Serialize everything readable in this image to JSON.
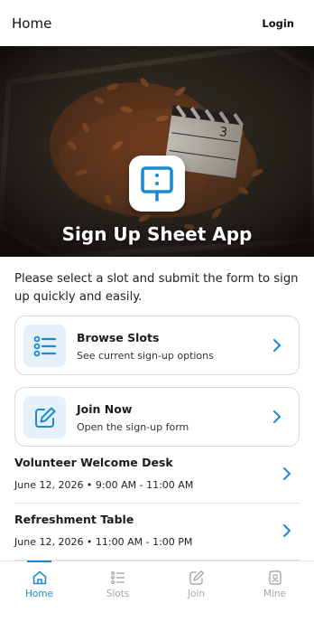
{
  "header": {
    "title": "Home",
    "login_label": "Login"
  },
  "hero": {
    "title": "Sign Up Sheet App",
    "icon": "easel-icon",
    "clapper_text": "3"
  },
  "intro_text": "Please select a slot and submit the form to sign up quickly and easily.",
  "cards": [
    {
      "title": "Browse Slots",
      "subtitle": "See current sign-up options",
      "icon": "list-icon"
    },
    {
      "title": "Join Now",
      "subtitle": "Open the sign-up form",
      "icon": "pencil-icon"
    }
  ],
  "slots": [
    {
      "title": "Volunteer Welcome Desk",
      "time": "June 12, 2026 • 9:00 AM - 11:00 AM"
    },
    {
      "title": "Refreshment Table",
      "time": "June 12, 2026 • 11:00 AM - 1:00 PM"
    }
  ],
  "tabs": [
    {
      "label": "Home",
      "icon": "home-icon",
      "active": true
    },
    {
      "label": "Slots",
      "icon": "list-icon",
      "active": false
    },
    {
      "label": "Join",
      "icon": "pencil-icon",
      "active": false
    },
    {
      "label": "Mine",
      "icon": "badge-icon",
      "active": false
    }
  ],
  "colors": {
    "accent": "#1a8ad3",
    "icon_bg": "#e4f1fb",
    "inactive": "#a8a8a8"
  }
}
